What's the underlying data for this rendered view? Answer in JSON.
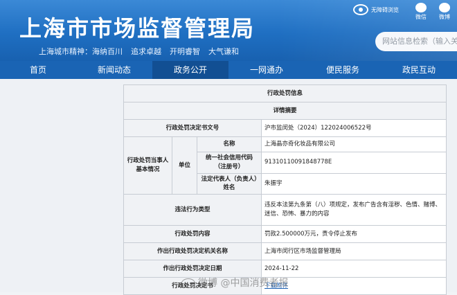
{
  "header": {
    "title": "上海市市场监督管理局",
    "spirit_label": "上海城市精神：",
    "spirit": [
      "海纳百川",
      "追求卓越",
      "开明睿智",
      "大气谦和"
    ],
    "accessibility_label": "无障碍浏览",
    "wechat_label": "微信",
    "weibo_label": "微博",
    "search_placeholder": "网站信息检索（输入关"
  },
  "nav": [
    "首页",
    "新闻动态",
    "政务公开",
    "一网通办",
    "便民服务",
    "政民互动"
  ],
  "nav_active_index": 2,
  "table": {
    "title": "行政处罚信息",
    "summary": "详情摘要",
    "doc_no_label": "行政处罚决定书文号",
    "doc_no": "沪市监闵处（2024）122024006522号",
    "party_label": "行政处罚当事人基本情况",
    "unit_label": "单位",
    "name_label": "名称",
    "name": "上海晶亦奇化妆品有限公司",
    "credit_label": "统一社会信用代码（注册号）",
    "credit": "91310110091848778E",
    "legal_label": "法定代表人（负责人）姓名",
    "legal": "朱振宇",
    "violation_label": "违法行为类型",
    "violation": "违反本法第九条第（八）项规定，发布广告含有淫秽、色情、赌博、迷信、恐怖、暴力的内容",
    "penalty_label": "行政处罚内容",
    "penalty": "罚款2.500000万元，责令停止发布",
    "authority_label": "作出行政处罚决定机关名称",
    "authority": "上海市闵行区市场监督管理局",
    "date_label": "作出行政处罚决定日期",
    "date": "2024-11-22",
    "document_label": "行政处罚决定书",
    "download": "下载附件"
  },
  "watermark": "微博 @中国消费者报"
}
